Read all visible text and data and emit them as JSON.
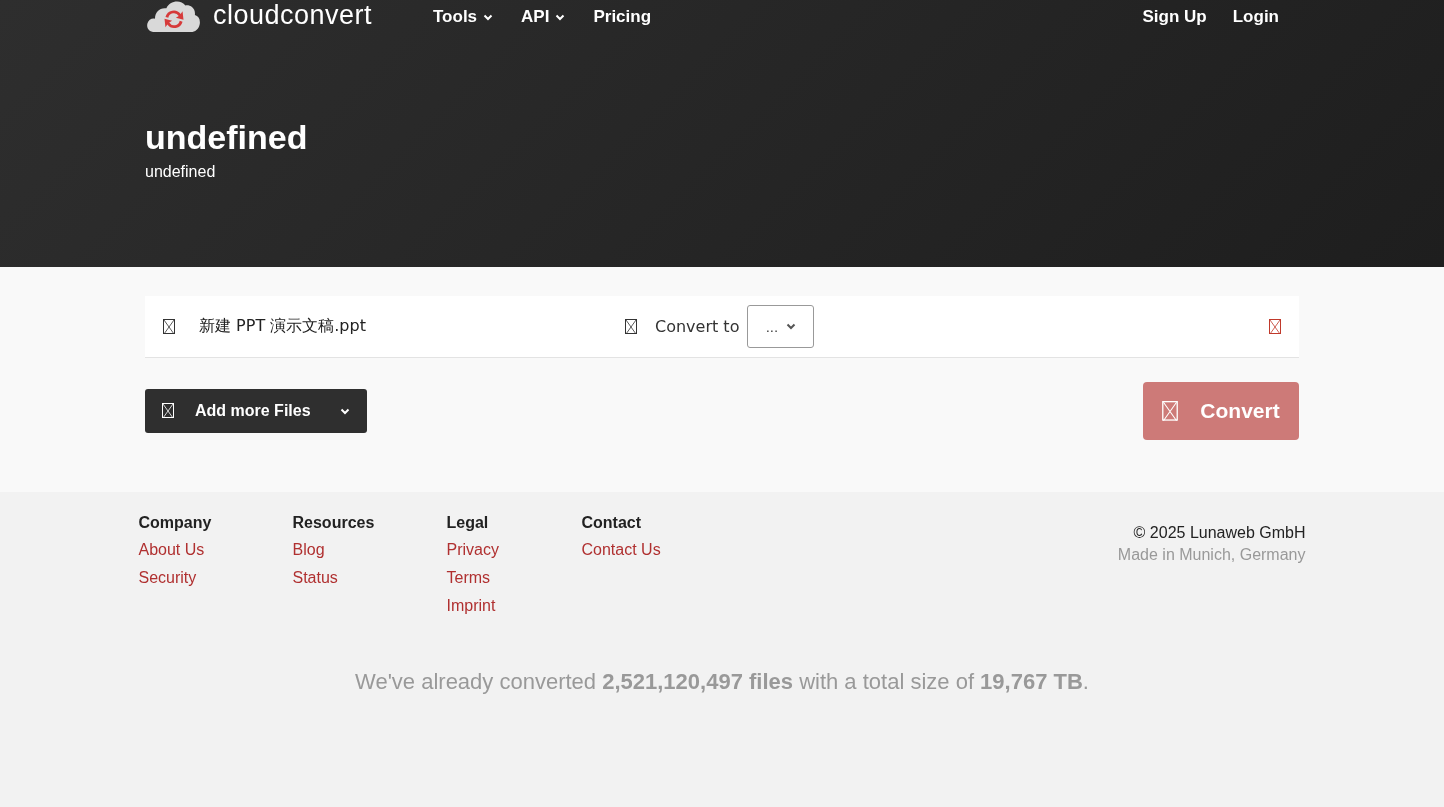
{
  "header": {
    "logo": "cloudconvert",
    "nav": [
      {
        "label": "Tools",
        "dropdown": true
      },
      {
        "label": "API",
        "dropdown": true
      },
      {
        "label": "Pricing",
        "dropdown": false
      }
    ],
    "account": [
      "Sign Up",
      "Login"
    ]
  },
  "hero": {
    "title": "undefined",
    "subtitle": "undefined"
  },
  "file_row": {
    "filename": "新建 PPT 演示文稿.ppt",
    "convert_label": "Convert to",
    "format_select": "..."
  },
  "add_button": {
    "label": "Add more Files"
  },
  "convert_button": {
    "label": "Convert",
    "disabled": true
  },
  "footer": {
    "columns": [
      {
        "heading": "Company",
        "links": [
          "About Us",
          "Security"
        ]
      },
      {
        "heading": "Resources",
        "links": [
          "Blog",
          "Status"
        ]
      },
      {
        "heading": "Legal",
        "links": [
          "Privacy",
          "Terms",
          "Imprint"
        ]
      },
      {
        "heading": "Contact",
        "links": [
          "Contact Us"
        ]
      }
    ],
    "copyright": "© 2025 Lunaweb GmbH",
    "made_in": "Made in Munich, Germany"
  },
  "stats": "We've already converted **2,521,120,497 files** with a total size of **19,767 TB**."
}
